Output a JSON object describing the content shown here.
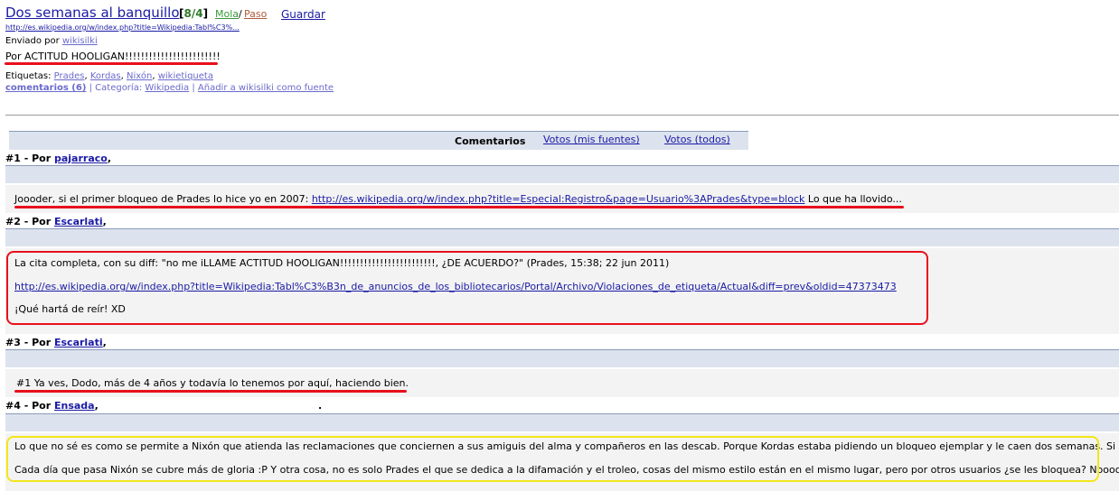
{
  "story": {
    "title": "Dos semanas al banquillo",
    "votes": "8/4",
    "mola": "Mola",
    "paso": "Paso",
    "save": "Guardar",
    "url": "http://es.wikipedia.org/w/index.php?title=Wikipedia:Tabl%C3%...",
    "sent_by_label": "Enviado por",
    "author": "wikisilki",
    "headline": "Por ACTITUD HOOLIGAN!!!!!!!!!!!!!!!!!!!!!!!!",
    "tags_label": "Etiquetas:",
    "tags": [
      "Prades",
      "Kordas",
      "Nixón",
      "wikietiqueta"
    ],
    "comments_link": "comentarios (6)",
    "category_label": "| Categoría:",
    "category": "Wikipedia",
    "add_source": "Añadir a wikisilki como fuente"
  },
  "tabs": {
    "current": "Comentarios",
    "votes_mine": "Votos (mis fuentes)",
    "votes_all": "Votos (todos)"
  },
  "comments": [
    {
      "header": "#1 - Por",
      "user": "pajarraco",
      "text_pre": "Joooder, si el primer bloqueo de Prades lo hice yo en 2007:",
      "link": "http://es.wikipedia.org/w/index.php?title=Especial:Registro&page=Usuario%3APrades&type=block",
      "text_post": "Lo que ha llovido..."
    },
    {
      "header": "#2 - Por",
      "user": "Escarlati",
      "line1": "La cita completa, con su diff: \"no me iLLAME ACTITUD HOOLIGAN!!!!!!!!!!!!!!!!!!!!!!!!, ¿DE ACUERDO?\" (Prades, 15:38; 22 jun 2011)",
      "link": "http://es.wikipedia.org/w/index.php?title=Wikipedia:Tabl%C3%B3n_de_anuncios_de_los_bibliotecarios/Portal/Archivo/Violaciones_de_etiqueta/Actual&diff=prev&oldid=47373473",
      "line3": "¡Qué hartá de reír! XD"
    },
    {
      "header": "#3 - Por",
      "user": "Escarlati",
      "text": "#1 Ya ves, Dodo, más de 4 años y todavía lo tenemos por aquí, haciendo bien."
    },
    {
      "header": "#4 - Por",
      "user": "Ensada",
      "trail": ".",
      "line1": "Lo que no sé es como se permite a Nixón que atienda las reclamaciones que conciernen a sus amiguis del alma y compañeros en las descab. Porque Kordas estaba pidiendo un bloqueo ejemplar y le caen dos semanas. Si soy",
      "line2": "Cada día que pasa Nixón se cubre más de gloria :P Y otra cosa, no es solo Prades el que se dedica a la difamación y el troleo, cosas del mismo estilo están en el mismo lugar, pero por otros usuarios ¿se les bloquea? Noooo, d"
    }
  ],
  "colors": {
    "link": "#1a1aa6",
    "annotation_red": "#e8101c",
    "annotation_yellow": "#f2e61a",
    "bar": "#dde3ee"
  }
}
